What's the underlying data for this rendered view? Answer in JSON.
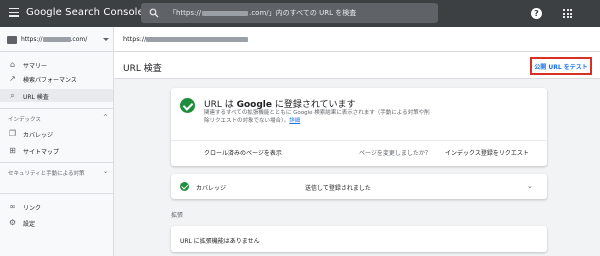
{
  "header": {
    "logo_google": "Google",
    "logo_product": "Search Console",
    "search_prefix": "「https://",
    "search_suffix": ".com/」内のすべての URL を検査",
    "help_glyph": "?",
    "icons": [
      "menu-icon",
      "search-icon",
      "help-icon",
      "apps-icon"
    ]
  },
  "sidebar": {
    "property_prefix": "https://",
    "property_suffix": ".com/",
    "items_top": [
      {
        "label": "サマリー",
        "icon": "home-icon",
        "glyph": "⌂"
      },
      {
        "label": "検索パフォーマンス",
        "icon": "trending-up-icon",
        "glyph": "↗"
      },
      {
        "label": "URL 検査",
        "icon": "search-icon",
        "glyph": "⌕"
      }
    ],
    "section_index": "インデックス",
    "items_index": [
      {
        "label": "カバレッジ",
        "icon": "file-copy-icon",
        "glyph": "❐"
      },
      {
        "label": "サイトマップ",
        "icon": "sitemap-icon",
        "glyph": "⊞"
      }
    ],
    "section_security": "セキュリティと手動による対策",
    "items_bottom": [
      {
        "label": "リンク",
        "icon": "link-icon",
        "glyph": "∞"
      },
      {
        "label": "設定",
        "icon": "gear-icon",
        "glyph": "⚙"
      }
    ],
    "caret_up": "^",
    "caret_down": "⌄"
  },
  "urlbar": {
    "prefix": "https://"
  },
  "page": {
    "title": "URL 検査",
    "test_button": "公開 URL をテスト"
  },
  "status_card": {
    "title_pre": "URL は ",
    "title_bold": "Google",
    "title_post": " に登録されています",
    "description": "関連するすべての拡張機能とともに Google 検索結果に表示されます（手動による対策や削除リクエストの対象でない場合）。",
    "details_link": "詳細",
    "crawled_page_link": "クロール済みのページを表示",
    "changed_question": "ページを変更しましたか？",
    "request_indexing_link": "インデックス登録をリクエスト"
  },
  "coverage": {
    "label": "カバレッジ",
    "value": "送信して登録されました",
    "caret": "⌄"
  },
  "extensions": {
    "section_label": "拡張",
    "none_text": "URL に拡張機能はありません"
  },
  "colors": {
    "header_bg": "#3c4043",
    "success_green": "#1e8e3e",
    "link_blue": "#1a73e8",
    "highlight_red": "#d93025"
  }
}
